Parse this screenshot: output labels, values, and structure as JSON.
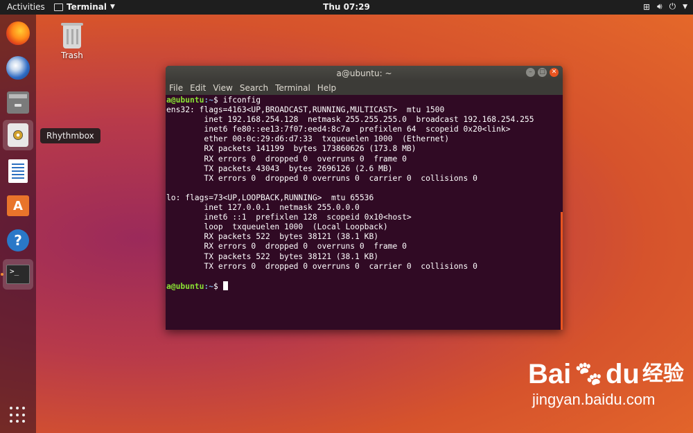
{
  "topbar": {
    "activities": "Activities",
    "app_name": "Terminal",
    "clock": "Thu 07:29"
  },
  "dock": {
    "tooltip": "Rhythmbox",
    "items": [
      {
        "name": "Firefox",
        "icon": "firefox-icon"
      },
      {
        "name": "Thunderbird",
        "icon": "thunderbird-icon"
      },
      {
        "name": "Files",
        "icon": "files-icon"
      },
      {
        "name": "Rhythmbox",
        "icon": "rhythmbox-icon"
      },
      {
        "name": "LibreOffice Writer",
        "icon": "writer-icon"
      },
      {
        "name": "Ubuntu Software",
        "icon": "software-icon",
        "glyph": "A"
      },
      {
        "name": "Help",
        "icon": "help-icon",
        "glyph": "?"
      },
      {
        "name": "Terminal",
        "icon": "terminal-icon",
        "glyph": ">_"
      }
    ]
  },
  "desktop": {
    "trash_label": "Trash"
  },
  "window": {
    "title": "a@ubuntu: ~",
    "menu": [
      "File",
      "Edit",
      "View",
      "Search",
      "Terminal",
      "Help"
    ],
    "prompt_user": "a@ubuntu",
    "prompt_path": ":~",
    "prompt_symbol": "$ ",
    "command": "ifconfig",
    "output": [
      "ens32: flags=4163<UP,BROADCAST,RUNNING,MULTICAST>  mtu 1500",
      "        inet 192.168.254.128  netmask 255.255.255.0  broadcast 192.168.254.255",
      "        inet6 fe80::ee13:7f07:eed4:8c7a  prefixlen 64  scopeid 0x20<link>",
      "        ether 00:0c:29:d6:d7:33  txqueuelen 1000  (Ethernet)",
      "        RX packets 141199  bytes 173860626 (173.8 MB)",
      "        RX errors 0  dropped 0  overruns 0  frame 0",
      "        TX packets 43043  bytes 2696126 (2.6 MB)",
      "        TX errors 0  dropped 0 overruns 0  carrier 0  collisions 0",
      "",
      "lo: flags=73<UP,LOOPBACK,RUNNING>  mtu 65536",
      "        inet 127.0.0.1  netmask 255.0.0.0",
      "        inet6 ::1  prefixlen 128  scopeid 0x10<host>",
      "        loop  txqueuelen 1000  (Local Loopback)",
      "        RX packets 522  bytes 38121 (38.1 KB)",
      "        RX errors 0  dropped 0  overruns 0  frame 0",
      "        TX packets 522  bytes 38121 (38.1 KB)",
      "        TX errors 0  dropped 0 overruns 0  carrier 0  collisions 0",
      ""
    ]
  },
  "watermark": {
    "brand_left": "Bai",
    "brand_right": "du",
    "brand_cn": "经验",
    "url": "jingyan.baidu.com"
  }
}
